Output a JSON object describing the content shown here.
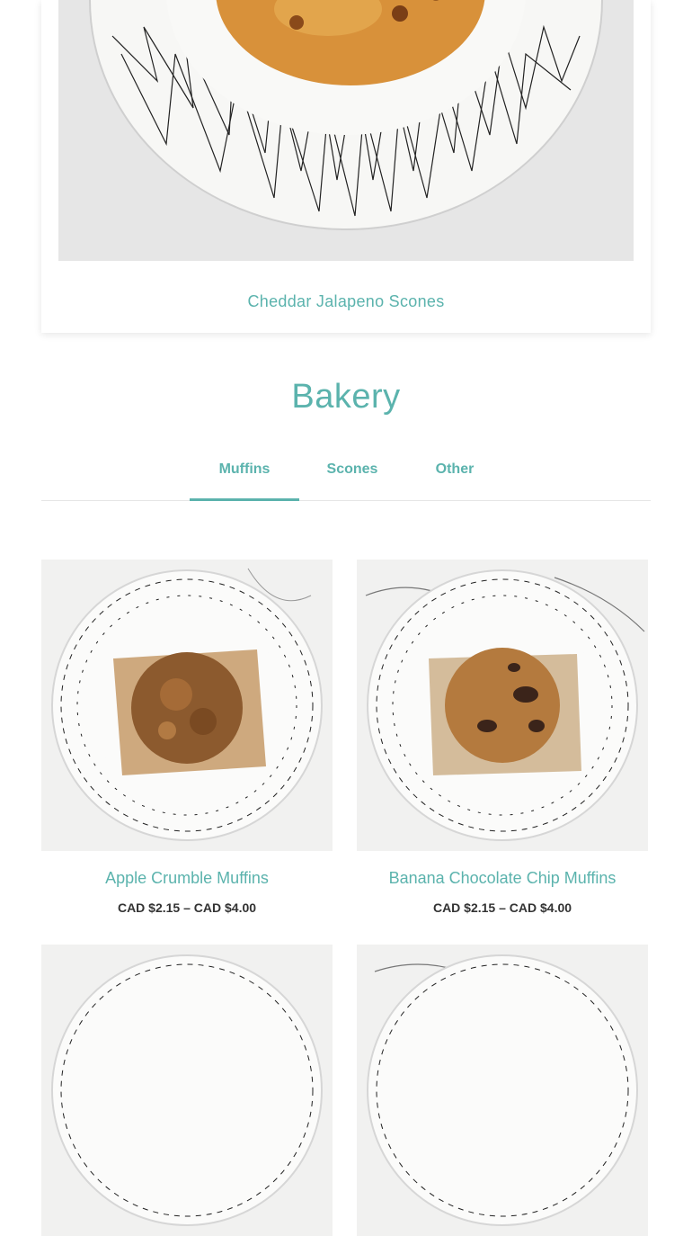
{
  "featured": {
    "title": "Cheddar Jalapeno Scones"
  },
  "section": {
    "title": "Bakery"
  },
  "tabs": [
    {
      "label": "Muffins",
      "active": true
    },
    {
      "label": "Scones",
      "active": false
    },
    {
      "label": "Other",
      "active": false
    }
  ],
  "products": [
    {
      "name": "Apple Crumble Muffins",
      "price": "CAD $2.15 – CAD $4.00"
    },
    {
      "name": "Banana Chocolate Chip Muffins",
      "price": "CAD $2.15 – CAD $4.00"
    }
  ],
  "colors": {
    "accent": "#5bb3ad"
  }
}
